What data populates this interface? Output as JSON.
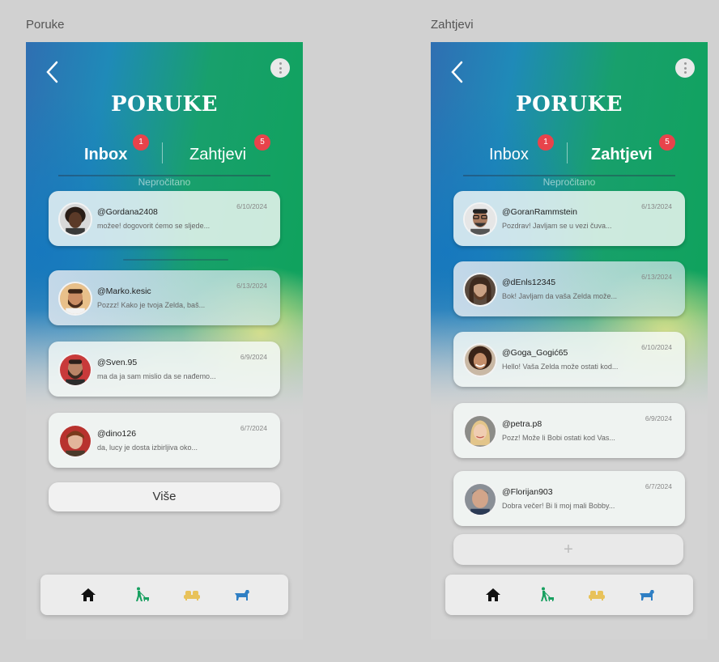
{
  "screens": [
    {
      "frame_label": "Poruke",
      "title": "PORUKE",
      "tabs": [
        {
          "label": "Inbox",
          "badge": "1",
          "active": true
        },
        {
          "label": "Zahtjevi",
          "badge": "5",
          "active": false
        }
      ],
      "unread_label": "Nepročitano",
      "messages": [
        {
          "user": "@Gordana2408",
          "text": "možee! dogovorit ćemo se sljede...",
          "date": "6/10/2024",
          "avatar": "woman-dark-avatar"
        },
        {
          "user": "@Marko.kesic",
          "text": "Pozzz! Kako je tvoja Zelda, baš...",
          "date": "6/13/2024",
          "avatar": "man-beard-avatar"
        },
        {
          "user": "@Sven.95",
          "text": "ma da ja sam mislio da se nađemo...",
          "date": "6/9/2024",
          "avatar": "man-red-avatar"
        },
        {
          "user": "@dino126",
          "text": "da, lucy je dosta izbirljiva oko...",
          "date": "6/7/2024",
          "avatar": "man-red-hair-avatar"
        }
      ],
      "more_label": "Više"
    },
    {
      "frame_label": "Zahtjevi",
      "title": "PORUKE",
      "tabs": [
        {
          "label": "Inbox",
          "badge": "1",
          "active": false
        },
        {
          "label": "Zahtjevi",
          "badge": "5",
          "active": true
        }
      ],
      "unread_label": "Nepročitano",
      "messages": [
        {
          "user": "@GoranRammstein",
          "text": "Pozdrav! Javljam se u vezi čuva...",
          "date": "6/13/2024",
          "avatar": "man-glasses-avatar"
        },
        {
          "user": "@dEnls12345",
          "text": "Bok! Javljam da vaša Zelda može...",
          "date": "6/13/2024",
          "avatar": "man-long-hair-avatar"
        },
        {
          "user": "@Goga_Gogić65",
          "text": "Hello! Vaša Zelda može ostati kod...",
          "date": "6/10/2024",
          "avatar": "woman-curly-avatar"
        },
        {
          "user": "@petra.p8",
          "text": "Pozz! Može li Bobi ostati kod Vas...",
          "date": "6/9/2024",
          "avatar": "woman-blonde-avatar"
        },
        {
          "user": "@Florijan903",
          "text": "Dobra večer! Bi li moj mali Bobby...",
          "date": "6/7/2024",
          "avatar": "old-man-avatar"
        }
      ],
      "add_label": "+"
    }
  ],
  "nav": [
    "home-icon",
    "dog-walking-icon",
    "sofa-icon",
    "dog-icon"
  ],
  "colors": {
    "accent_green": "#0ea35a",
    "accent_blue": "#2f6fb2",
    "badge": "#e8434b",
    "nav_home": "#111111",
    "nav_walk": "#18a060",
    "nav_sofa": "#e8c25a",
    "nav_dog": "#2f7fc4"
  }
}
